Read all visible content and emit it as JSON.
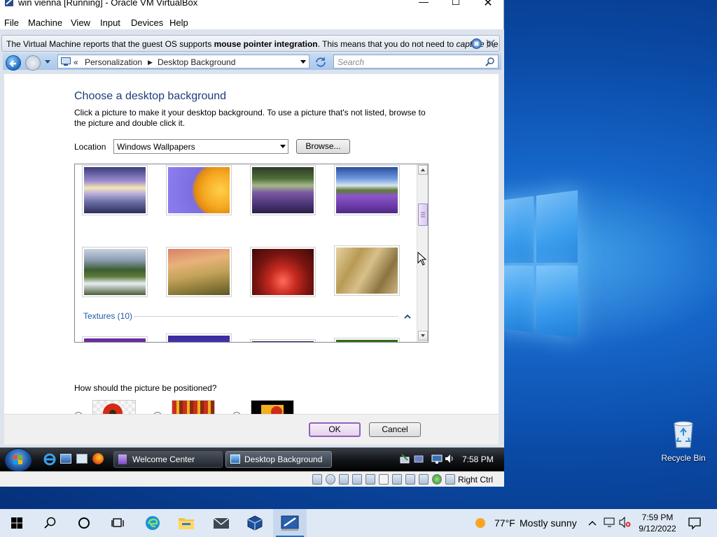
{
  "vbox": {
    "title": "win vienna [Running] - Oracle VM VirtualBox",
    "menu": [
      "File",
      "Machine",
      "View",
      "Input",
      "Devices",
      "Help"
    ],
    "notice_prefix": "The Virtual Machine reports that the guest OS supports ",
    "notice_bold": "mouse pointer integration",
    "notice_mid": ". This means that you do not need to ",
    "notice_italic": "capture",
    "notice_suffix": " the",
    "status_host_key": "Right Ctrl"
  },
  "explorer": {
    "breadcrumb_sep": "«",
    "breadcrumb": [
      "Personalization",
      "Desktop Background"
    ],
    "search_placeholder": "Search"
  },
  "dialog": {
    "heading": "Choose a desktop background",
    "instructions": "Click a picture to make it your desktop background. To use a picture that's not listed, browse to the picture and double click it.",
    "location_label": "Location",
    "location_value": "Windows Wallpapers",
    "browse_label": "Browse...",
    "group_label": "Textures (10)",
    "position_question": "How should the picture be positioned?",
    "position_selected": 0,
    "ok_label": "OK",
    "cancel_label": "Cancel"
  },
  "vista_taskbar": {
    "buttons": [
      "Welcome Center",
      "Desktop Background"
    ],
    "clock": "7:58 PM"
  },
  "desktop": {
    "recycle_bin": "Recycle Bin"
  },
  "w10_taskbar": {
    "weather_temp": "77°F",
    "weather_text": "Mostly sunny",
    "time": "7:59 PM",
    "date": "9/12/2022"
  }
}
